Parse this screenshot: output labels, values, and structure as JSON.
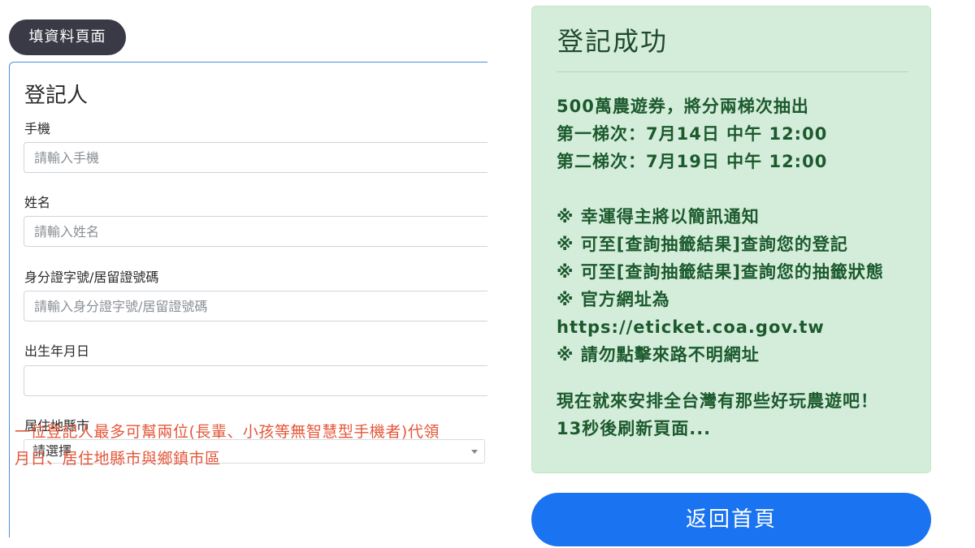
{
  "form": {
    "tag": "填資料頁面",
    "title": "登記人",
    "phone": {
      "label": "手機",
      "placeholder": "請輸入手機"
    },
    "name": {
      "label": "姓名",
      "placeholder": "請輸入姓名"
    },
    "id": {
      "label": "身分證字號/居留證號碼",
      "placeholder": "請輸入身分證字號/居留證號碼"
    },
    "birth": {
      "label": "出生年月日",
      "placeholder": ""
    },
    "city": {
      "label": "居住地縣市",
      "selected": "請選擇"
    },
    "warning": {
      "line1": "一位登記人最多可幫兩位(長輩、小孩等無智慧型手機者)代領",
      "line2": "月日、居住地縣市與鄉鎮市區"
    }
  },
  "success": {
    "title": "登記成功",
    "lines_a": [
      "500萬農遊券，將分兩梯次抽出",
      "第一梯次：7月14日 中午 12:00",
      "第二梯次：7月19日 中午 12:00"
    ],
    "lines_b": [
      "※ 幸運得主將以簡訊通知",
      "※ 可至[查詢抽籤結果]查詢您的登記",
      "※ 可至[查詢抽籤結果]查詢您的抽籤狀態",
      "※ 官方網址為",
      "https://eticket.coa.gov.tw",
      "※ 請勿點擊來路不明網址"
    ],
    "lines_c": [
      "現在就來安排全台灣有那些好玩農遊吧！",
      "13秒後刷新頁面..."
    ]
  },
  "home_button": "返回首頁",
  "colors": {
    "accent": "#1a73f0",
    "success_bg": "#d4edda",
    "warning_text": "#e4573a",
    "tag_bg": "#3a3a46"
  }
}
